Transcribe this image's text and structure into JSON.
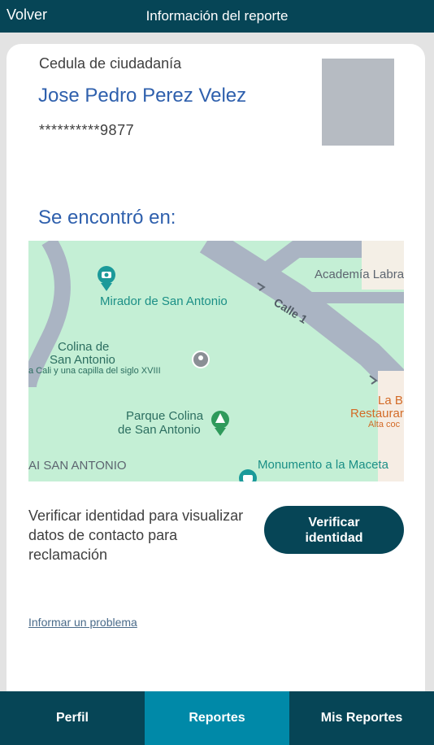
{
  "header": {
    "back_label": "Volver",
    "title": "Información del reporte"
  },
  "document": {
    "type": "Cedula de ciudadanía",
    "owner_name": "Jose Pedro Perez Velez",
    "number_masked": "**********9877"
  },
  "location": {
    "heading": "Se encontró en:",
    "map_labels": {
      "mirador": "Mirador de San Antonio",
      "academia": "Academía Labra",
      "calle": "Calle 1",
      "colina_line1": "Colina de",
      "colina_line2": "San Antonio",
      "colina_desc": "a Cali y una capilla del siglo XVIII",
      "parque_line1": "Parque Colina",
      "parque_line2": "de San Antonio",
      "restaurant_line1": "La B",
      "restaurant_line2": "Restaurar",
      "restaurant_line3": "Alta coc",
      "san_antonio": "AI SAN ANTONIO",
      "monumento": "Monumento a la Maceta"
    }
  },
  "verify": {
    "description": "Verificar identidad para visualizar datos de contacto para reclamación",
    "button_line1": "Verificar",
    "button_line2": "identidad"
  },
  "report_problem_label": "Informar un problema",
  "nav": {
    "tabs": [
      {
        "label": "Perfil",
        "active": false
      },
      {
        "label": "Reportes",
        "active": true
      },
      {
        "label": "Mis Reportes",
        "active": false
      }
    ]
  },
  "colors": {
    "primary": "#064556",
    "accent": "#0089a8",
    "heading_blue": "#2f60ad",
    "map_green": "#c4efd5"
  }
}
